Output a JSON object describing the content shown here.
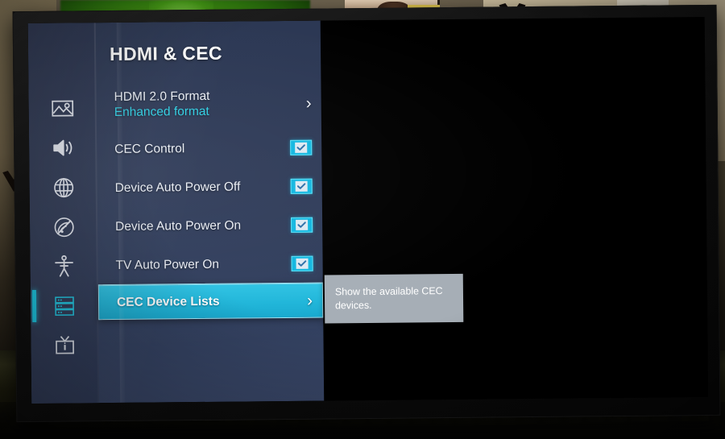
{
  "device": {
    "type": "television",
    "screen_state": "settings-menu-overlay"
  },
  "settings_panel": {
    "title": "HDMI & CEC",
    "accent_color": "#20b6da",
    "panel_background": "#2e3a57",
    "sublabel_color": "#2ecfe4"
  },
  "icon_rail": {
    "items": [
      {
        "name": "picture-icon",
        "label": "Picture",
        "active": false
      },
      {
        "name": "sound-icon",
        "label": "Sound",
        "active": false
      },
      {
        "name": "network-globe-icon",
        "label": "Network",
        "active": false
      },
      {
        "name": "no-broadcast-icon",
        "label": "Broadcasting",
        "active": false
      },
      {
        "name": "accessibility-icon",
        "label": "Accessibility",
        "active": false
      },
      {
        "name": "general-list-icon",
        "label": "General",
        "active": true
      },
      {
        "name": "support-tv-icon",
        "label": "Support",
        "active": false
      }
    ]
  },
  "menu": {
    "items": [
      {
        "label": "HDMI 2.0 Format",
        "sublabel": "Enhanced format",
        "control": "chevron",
        "chevron": "›",
        "selected": false
      },
      {
        "label": "CEC Control",
        "control": "checkbox",
        "checked": true,
        "selected": false
      },
      {
        "label": "Device Auto Power Off",
        "control": "checkbox",
        "checked": true,
        "selected": false
      },
      {
        "label": "Device Auto Power On",
        "control": "checkbox",
        "checked": true,
        "selected": false
      },
      {
        "label": "TV Auto Power On",
        "control": "checkbox",
        "checked": true,
        "selected": false
      },
      {
        "label": "CEC Device Lists",
        "control": "chevron",
        "chevron": "›",
        "selected": true
      }
    ]
  },
  "tooltip": {
    "text": "Show the available CEC devices.",
    "background_color": "#a6aeb6"
  }
}
